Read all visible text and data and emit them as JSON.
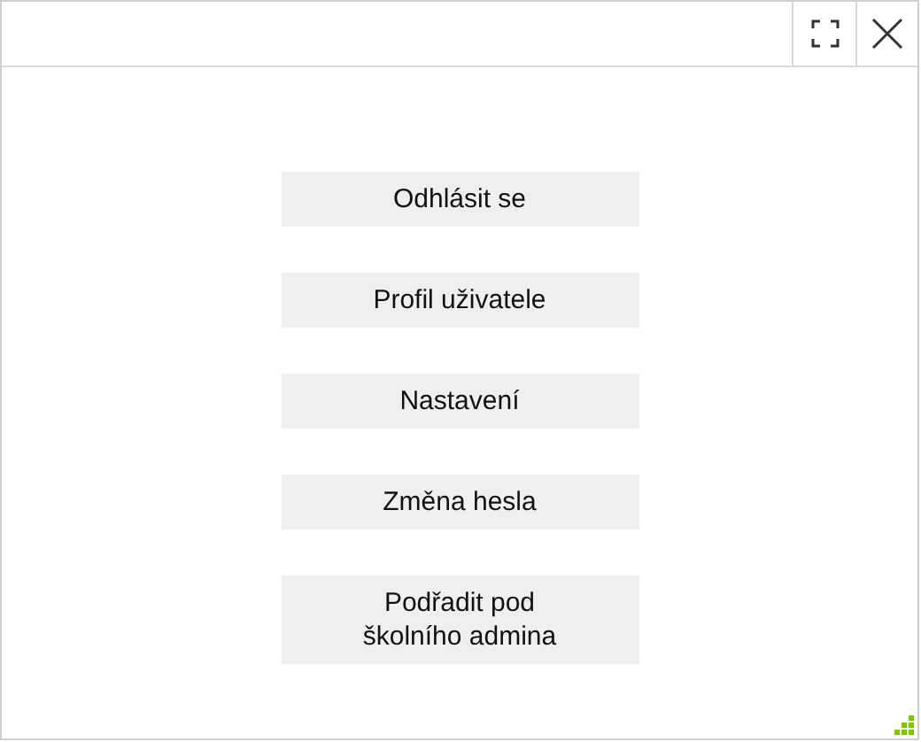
{
  "menu": [
    {
      "label": "Odhlásit se"
    },
    {
      "label": "Profil uživatele"
    },
    {
      "label": "Nastavení"
    },
    {
      "label": "Změna hesla"
    },
    {
      "label": "Podřadit pod školního admina"
    }
  ]
}
